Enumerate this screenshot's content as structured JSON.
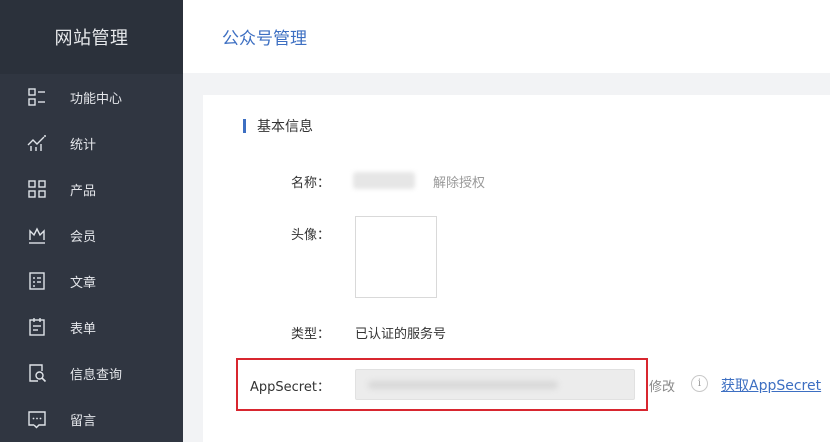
{
  "sidebar": {
    "title": "网站管理",
    "items": [
      {
        "label": "功能中心",
        "icon": "function-center-icon"
      },
      {
        "label": "统计",
        "icon": "statistics-chart-icon"
      },
      {
        "label": "产品",
        "icon": "grid-icon"
      },
      {
        "label": "会员",
        "icon": "crown-icon"
      },
      {
        "label": "文章",
        "icon": "article-icon"
      },
      {
        "label": "表单",
        "icon": "form-clipboard-icon"
      },
      {
        "label": "信息查询",
        "icon": "search-document-icon"
      },
      {
        "label": "留言",
        "icon": "message-icon"
      }
    ]
  },
  "header": {
    "title": "公众号管理"
  },
  "section": {
    "title": "基本信息"
  },
  "form": {
    "name_label": "名称：",
    "revoke_label": "解除授权",
    "avatar_label": "头像：",
    "type_label": "类型：",
    "type_value": "已认证的服务号",
    "appsecret_label": "AppSecret：",
    "modify_label": "修改",
    "info_glyph": "i",
    "get_appsecret_label": "获取AppSecret"
  },
  "colors": {
    "accent": "#3d6fc2",
    "sidebar_bg": "#303641",
    "highlight": "#d8262f"
  }
}
